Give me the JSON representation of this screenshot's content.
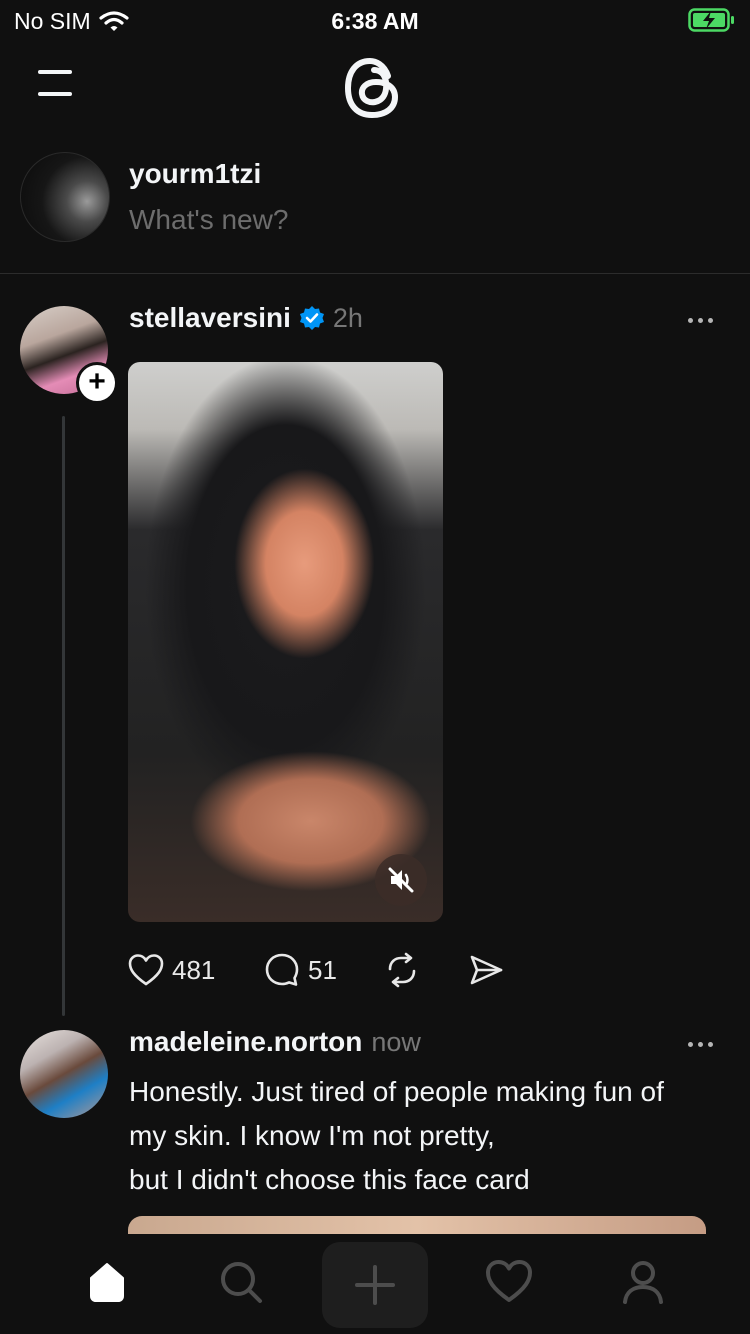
{
  "status_bar": {
    "carrier": "No SIM",
    "time": "6:38 AM"
  },
  "composer": {
    "username": "yourm1tzi",
    "placeholder": "What's new?"
  },
  "posts": [
    {
      "username": "stellaversini",
      "verified": true,
      "time": "2h",
      "likes": "481",
      "replies": "51"
    },
    {
      "username": "madeleine.norton",
      "time": "now",
      "text_lines": [
        "Honestly. Just tired of people making fun of",
        "my skin. I know I'm not pretty,",
        "but I didn't choose this face card"
      ]
    }
  ],
  "icons": {
    "menu": "hamburger-icon",
    "logo": "threads-logo",
    "more": "more-dots-icon",
    "like": "heart-icon",
    "reply": "comment-icon",
    "repost": "repost-icon",
    "share": "send-icon",
    "mute": "volume-muted-icon",
    "nav": [
      "home-icon",
      "search-icon",
      "plus-icon",
      "heart-icon",
      "profile-icon"
    ]
  },
  "colors": {
    "background": "#101010",
    "text": "#f3f5f7",
    "muted": "#777777",
    "verified": "#0095f6",
    "battery": "#4cd964"
  }
}
